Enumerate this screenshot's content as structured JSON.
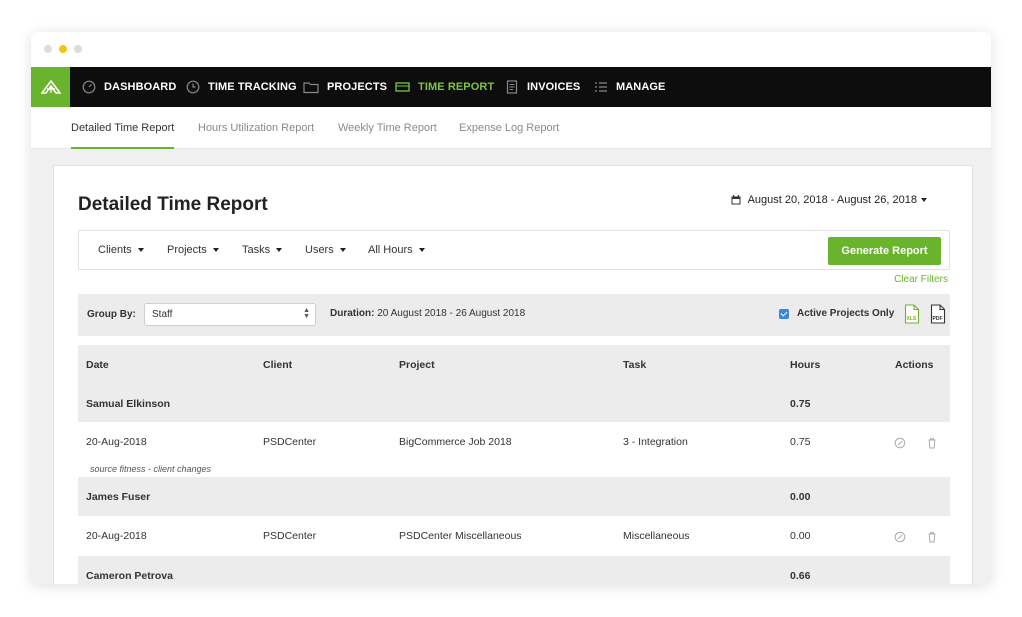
{
  "nav": {
    "items": [
      {
        "label": "DASHBOARD",
        "icon": "gauge-icon"
      },
      {
        "label": "TIME TRACKING",
        "icon": "clock-icon"
      },
      {
        "label": "PROJECTS",
        "icon": "folder-icon"
      },
      {
        "label": "TIME REPORT",
        "icon": "report-icon",
        "active": true
      },
      {
        "label": "INVOICES",
        "icon": "invoice-icon"
      },
      {
        "label": "MANAGE",
        "icon": "list-icon"
      }
    ]
  },
  "subnav": {
    "tabs": [
      {
        "label": "Detailed Time Report",
        "active": true
      },
      {
        "label": "Hours Utilization Report"
      },
      {
        "label": "Weekly Time Report"
      },
      {
        "label": "Expense Log Report"
      }
    ]
  },
  "page": {
    "title": "Detailed Time Report",
    "date_range": "August 20, 2018 - August 26, 2018"
  },
  "filters": {
    "items": [
      "Clients",
      "Projects",
      "Tasks",
      "Users",
      "All Hours"
    ],
    "generate_label": "Generate Report",
    "clear_label": "Clear Filters"
  },
  "groupbar": {
    "label": "Group By:",
    "selected": "Staff",
    "duration_label": "Duration:",
    "duration_value": "20 August 2018 - 26 August 2018",
    "active_only_label": "Active Projects Only",
    "active_only_checked": true,
    "export_xls": "XLS",
    "export_pdf": "PDF"
  },
  "table": {
    "headers": [
      "Date",
      "Client",
      "Project",
      "Task",
      "Hours",
      "Actions"
    ],
    "groups": [
      {
        "name": "Samual Elkinson",
        "hours": "0.75",
        "entries": [
          {
            "date": "20-Aug-2018",
            "client": "PSDCenter",
            "project": "BigCommerce Job 2018",
            "task": "3 - Integration",
            "hours": "0.75",
            "note": "source fitness - client changes"
          }
        ]
      },
      {
        "name": "James Fuser",
        "hours": "0.00",
        "entries": [
          {
            "date": "20-Aug-2018",
            "client": "PSDCenter",
            "project": "PSDCenter Miscellaneous",
            "task": "Miscellaneous",
            "hours": "0.00",
            "note": ""
          }
        ]
      },
      {
        "name": "Cameron Petrova",
        "hours": "0.66",
        "entries": []
      }
    ]
  },
  "colors": {
    "accent": "#6ab42d",
    "nav_bg": "#0d0d0d",
    "active_nav": "#7cc53e",
    "checkbox": "#3a86d8"
  }
}
